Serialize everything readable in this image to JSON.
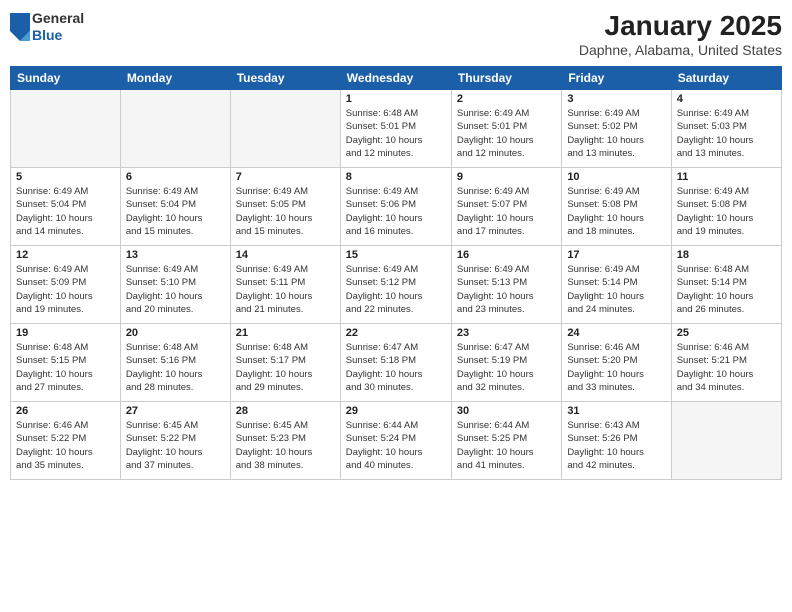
{
  "header": {
    "logo": {
      "general": "General",
      "blue": "Blue"
    },
    "title": "January 2025",
    "subtitle": "Daphne, Alabama, United States"
  },
  "calendar": {
    "headers": [
      "Sunday",
      "Monday",
      "Tuesday",
      "Wednesday",
      "Thursday",
      "Friday",
      "Saturday"
    ],
    "weeks": [
      [
        {
          "day": "",
          "info": ""
        },
        {
          "day": "",
          "info": ""
        },
        {
          "day": "",
          "info": ""
        },
        {
          "day": "1",
          "info": "Sunrise: 6:48 AM\nSunset: 5:01 PM\nDaylight: 10 hours\nand 12 minutes."
        },
        {
          "day": "2",
          "info": "Sunrise: 6:49 AM\nSunset: 5:01 PM\nDaylight: 10 hours\nand 12 minutes."
        },
        {
          "day": "3",
          "info": "Sunrise: 6:49 AM\nSunset: 5:02 PM\nDaylight: 10 hours\nand 13 minutes."
        },
        {
          "day": "4",
          "info": "Sunrise: 6:49 AM\nSunset: 5:03 PM\nDaylight: 10 hours\nand 13 minutes."
        }
      ],
      [
        {
          "day": "5",
          "info": "Sunrise: 6:49 AM\nSunset: 5:04 PM\nDaylight: 10 hours\nand 14 minutes."
        },
        {
          "day": "6",
          "info": "Sunrise: 6:49 AM\nSunset: 5:04 PM\nDaylight: 10 hours\nand 15 minutes."
        },
        {
          "day": "7",
          "info": "Sunrise: 6:49 AM\nSunset: 5:05 PM\nDaylight: 10 hours\nand 15 minutes."
        },
        {
          "day": "8",
          "info": "Sunrise: 6:49 AM\nSunset: 5:06 PM\nDaylight: 10 hours\nand 16 minutes."
        },
        {
          "day": "9",
          "info": "Sunrise: 6:49 AM\nSunset: 5:07 PM\nDaylight: 10 hours\nand 17 minutes."
        },
        {
          "day": "10",
          "info": "Sunrise: 6:49 AM\nSunset: 5:08 PM\nDaylight: 10 hours\nand 18 minutes."
        },
        {
          "day": "11",
          "info": "Sunrise: 6:49 AM\nSunset: 5:08 PM\nDaylight: 10 hours\nand 19 minutes."
        }
      ],
      [
        {
          "day": "12",
          "info": "Sunrise: 6:49 AM\nSunset: 5:09 PM\nDaylight: 10 hours\nand 19 minutes."
        },
        {
          "day": "13",
          "info": "Sunrise: 6:49 AM\nSunset: 5:10 PM\nDaylight: 10 hours\nand 20 minutes."
        },
        {
          "day": "14",
          "info": "Sunrise: 6:49 AM\nSunset: 5:11 PM\nDaylight: 10 hours\nand 21 minutes."
        },
        {
          "day": "15",
          "info": "Sunrise: 6:49 AM\nSunset: 5:12 PM\nDaylight: 10 hours\nand 22 minutes."
        },
        {
          "day": "16",
          "info": "Sunrise: 6:49 AM\nSunset: 5:13 PM\nDaylight: 10 hours\nand 23 minutes."
        },
        {
          "day": "17",
          "info": "Sunrise: 6:49 AM\nSunset: 5:14 PM\nDaylight: 10 hours\nand 24 minutes."
        },
        {
          "day": "18",
          "info": "Sunrise: 6:48 AM\nSunset: 5:14 PM\nDaylight: 10 hours\nand 26 minutes."
        }
      ],
      [
        {
          "day": "19",
          "info": "Sunrise: 6:48 AM\nSunset: 5:15 PM\nDaylight: 10 hours\nand 27 minutes."
        },
        {
          "day": "20",
          "info": "Sunrise: 6:48 AM\nSunset: 5:16 PM\nDaylight: 10 hours\nand 28 minutes."
        },
        {
          "day": "21",
          "info": "Sunrise: 6:48 AM\nSunset: 5:17 PM\nDaylight: 10 hours\nand 29 minutes."
        },
        {
          "day": "22",
          "info": "Sunrise: 6:47 AM\nSunset: 5:18 PM\nDaylight: 10 hours\nand 30 minutes."
        },
        {
          "day": "23",
          "info": "Sunrise: 6:47 AM\nSunset: 5:19 PM\nDaylight: 10 hours\nand 32 minutes."
        },
        {
          "day": "24",
          "info": "Sunrise: 6:46 AM\nSunset: 5:20 PM\nDaylight: 10 hours\nand 33 minutes."
        },
        {
          "day": "25",
          "info": "Sunrise: 6:46 AM\nSunset: 5:21 PM\nDaylight: 10 hours\nand 34 minutes."
        }
      ],
      [
        {
          "day": "26",
          "info": "Sunrise: 6:46 AM\nSunset: 5:22 PM\nDaylight: 10 hours\nand 35 minutes."
        },
        {
          "day": "27",
          "info": "Sunrise: 6:45 AM\nSunset: 5:22 PM\nDaylight: 10 hours\nand 37 minutes."
        },
        {
          "day": "28",
          "info": "Sunrise: 6:45 AM\nSunset: 5:23 PM\nDaylight: 10 hours\nand 38 minutes."
        },
        {
          "day": "29",
          "info": "Sunrise: 6:44 AM\nSunset: 5:24 PM\nDaylight: 10 hours\nand 40 minutes."
        },
        {
          "day": "30",
          "info": "Sunrise: 6:44 AM\nSunset: 5:25 PM\nDaylight: 10 hours\nand 41 minutes."
        },
        {
          "day": "31",
          "info": "Sunrise: 6:43 AM\nSunset: 5:26 PM\nDaylight: 10 hours\nand 42 minutes."
        },
        {
          "day": "",
          "info": ""
        }
      ]
    ]
  }
}
